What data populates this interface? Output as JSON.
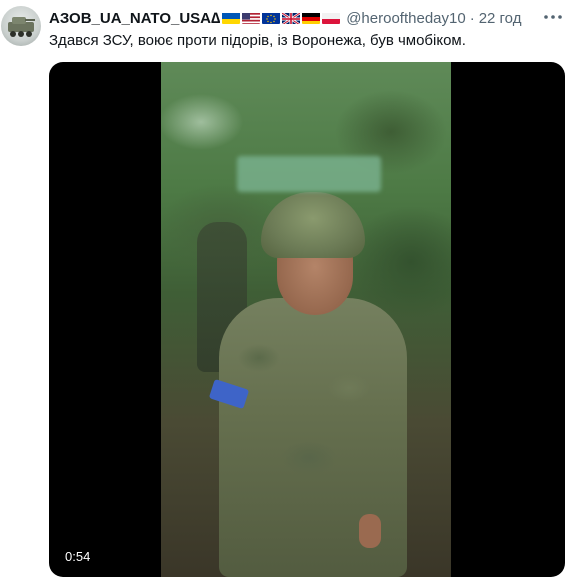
{
  "tweet": {
    "display_name": "АЗОВ_UA_NATO_USA",
    "name_suffix": "∆",
    "flags": [
      "ukraine-flag",
      "usa-flag",
      "eu-flag",
      "uk-flag",
      "germany-flag",
      "poland-flag"
    ],
    "handle": "@herooftheday10",
    "separator": "·",
    "time": "22 год",
    "text": "Здався ЗСУ, воює проти підорів, із Воронежа, був чмобіком."
  },
  "media": {
    "duration": "0:54"
  },
  "colors": {
    "text": "#0f1419",
    "secondary": "#536471",
    "media_bg": "#000000",
    "armband": "#3e64c8"
  },
  "icons": {
    "more": "more-horizontal-icon",
    "avatar": "armored-vehicle-avatar"
  }
}
